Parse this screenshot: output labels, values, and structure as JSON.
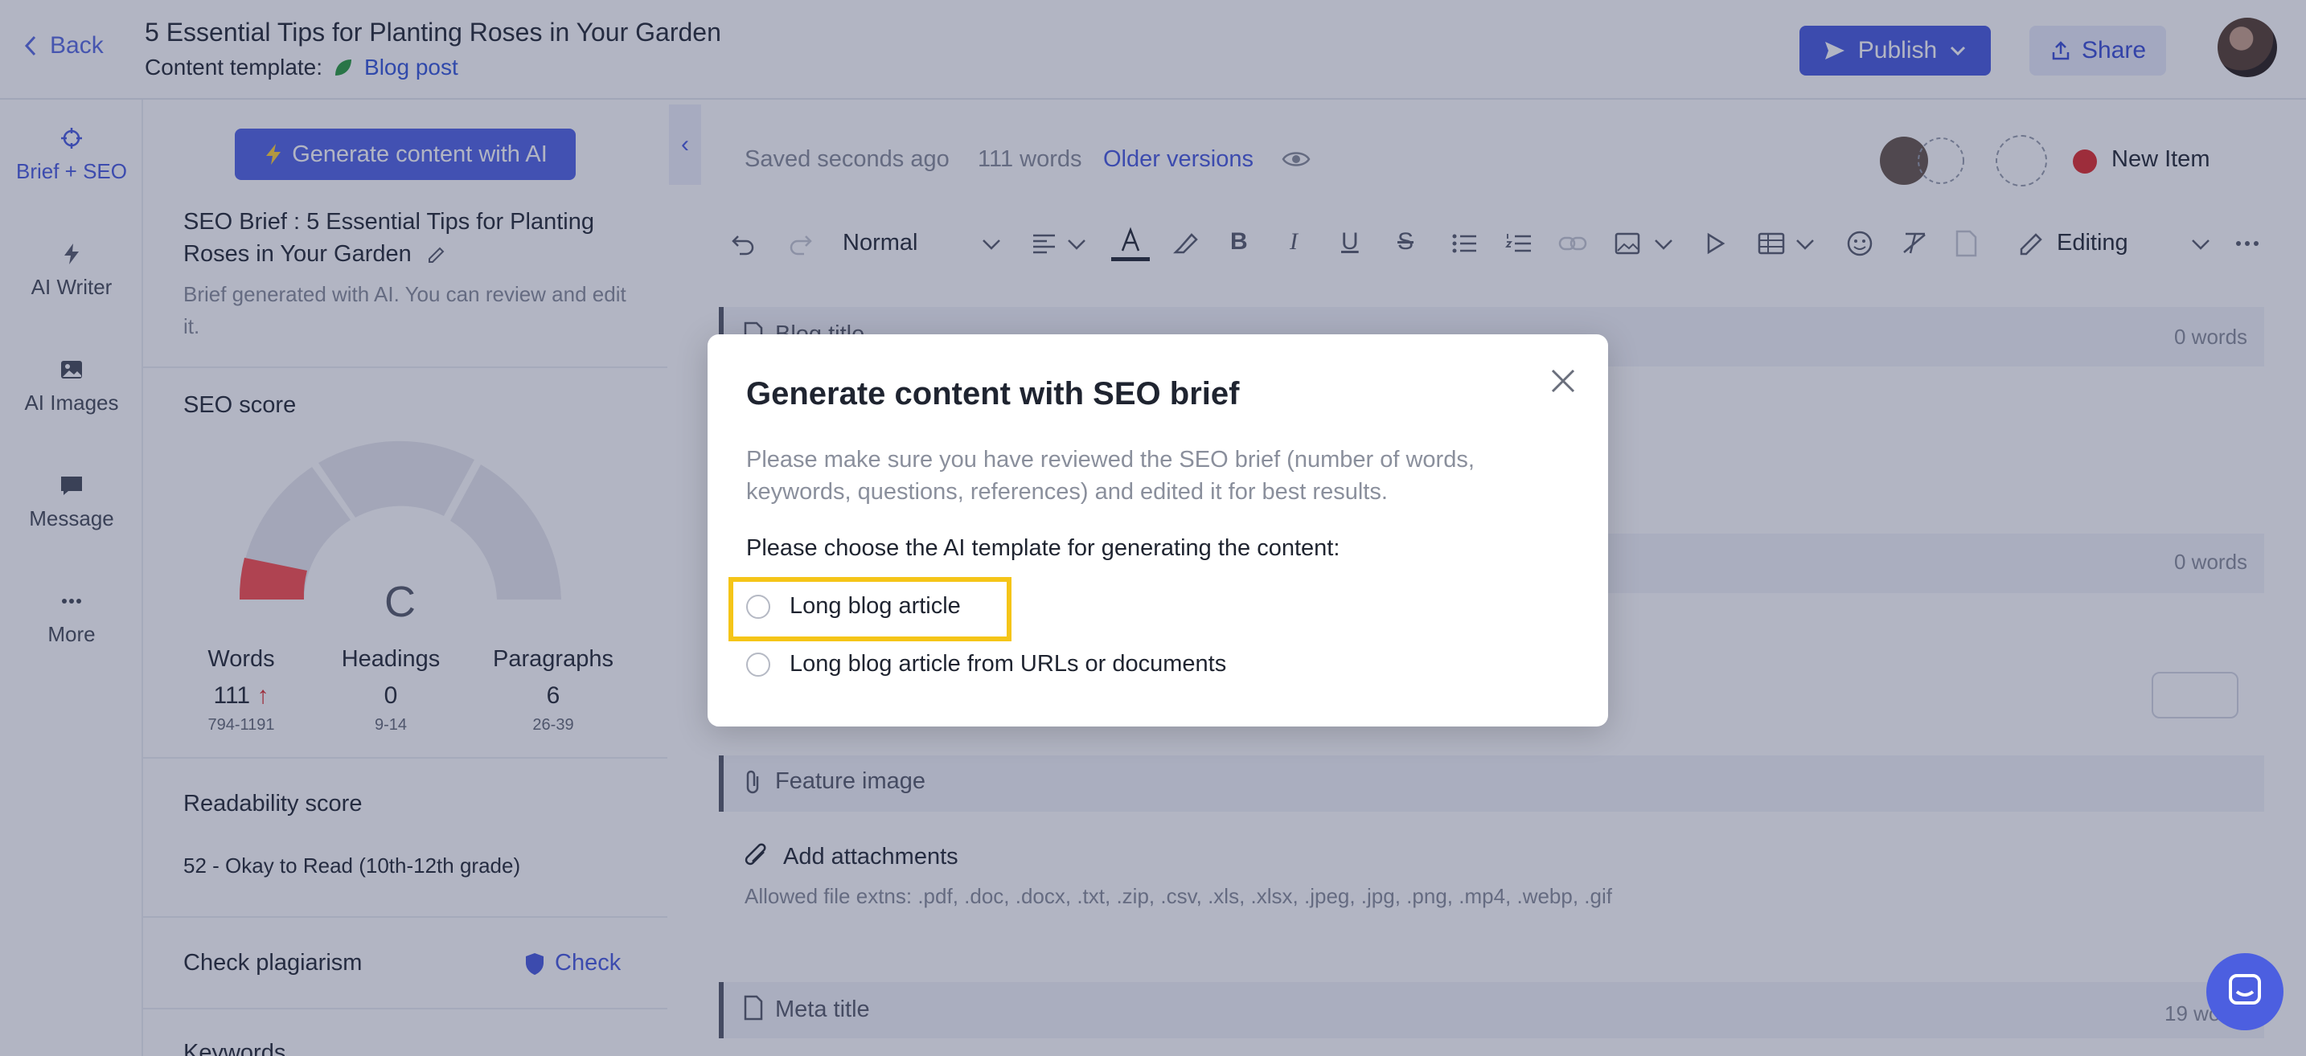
{
  "header": {
    "back_label": "Back",
    "title": "5 Essential Tips for Planting Roses in Your Garden",
    "template_label": "Content template:",
    "template_value": "Blog post",
    "publish_label": "Publish",
    "share_label": "Share"
  },
  "rail": {
    "items": [
      {
        "label": "Brief + SEO",
        "icon": "crosshair-icon"
      },
      {
        "label": "AI Writer",
        "icon": "lightning-icon"
      },
      {
        "label": "AI Images",
        "icon": "image-icon"
      },
      {
        "label": "Message",
        "icon": "message-icon"
      },
      {
        "label": "More",
        "icon": "more-dots-icon"
      }
    ]
  },
  "brief": {
    "generate_button": "Generate content with AI",
    "title": "SEO Brief : 5 Essential Tips for Planting Roses in Your Garden",
    "note": "Brief generated with AI. You can review and edit it.",
    "seo_score_label": "SEO score",
    "grade": "C",
    "metrics": [
      {
        "label": "Words",
        "value": "111",
        "range": "794-1191"
      },
      {
        "label": "Headings",
        "value": "0",
        "range": "9-14"
      },
      {
        "label": "Paragraphs",
        "value": "6",
        "range": "26-39"
      }
    ],
    "readability_label": "Readability score",
    "readability_value": "52 - Okay to Read (10th-12th grade)",
    "plagiarism_label": "Check plagiarism",
    "plagiarism_action": "Check",
    "keywords_label": "Keywords"
  },
  "editor": {
    "saved": "Saved seconds ago",
    "words": "111 words",
    "older_versions": "Older versions",
    "status": "New Item",
    "status_color": "#e03131",
    "style_select": "Normal",
    "mode_select": "Editing",
    "blog_title_label": "Blog title",
    "blog_title_words": "0 words",
    "second_words": "0 words",
    "feature_image_label": "Feature image",
    "attach_label": "Add attachments",
    "attach_note": "Allowed file extns: .pdf, .doc, .docx, .txt, .zip, .csv, .xls, .xlsx, .jpeg, .jpg, .png, .mp4, .webp, .gif",
    "meta_title_label": "Meta title",
    "meta_title_words": "19 wo"
  },
  "modal": {
    "title": "Generate content with SEO brief",
    "description": "Please make sure you have reviewed the SEO brief (number of words, keywords, questions, references) and edited it for best results.",
    "question": "Please choose the AI template for generating the content:",
    "options": [
      {
        "label": "Long blog article"
      },
      {
        "label": "Long blog article from URLs or documents"
      }
    ],
    "highlight_color": "#f5c518"
  },
  "colors": {
    "accent": "#4c5fe0",
    "overlay": "rgba(30,38,78,0.34)"
  }
}
